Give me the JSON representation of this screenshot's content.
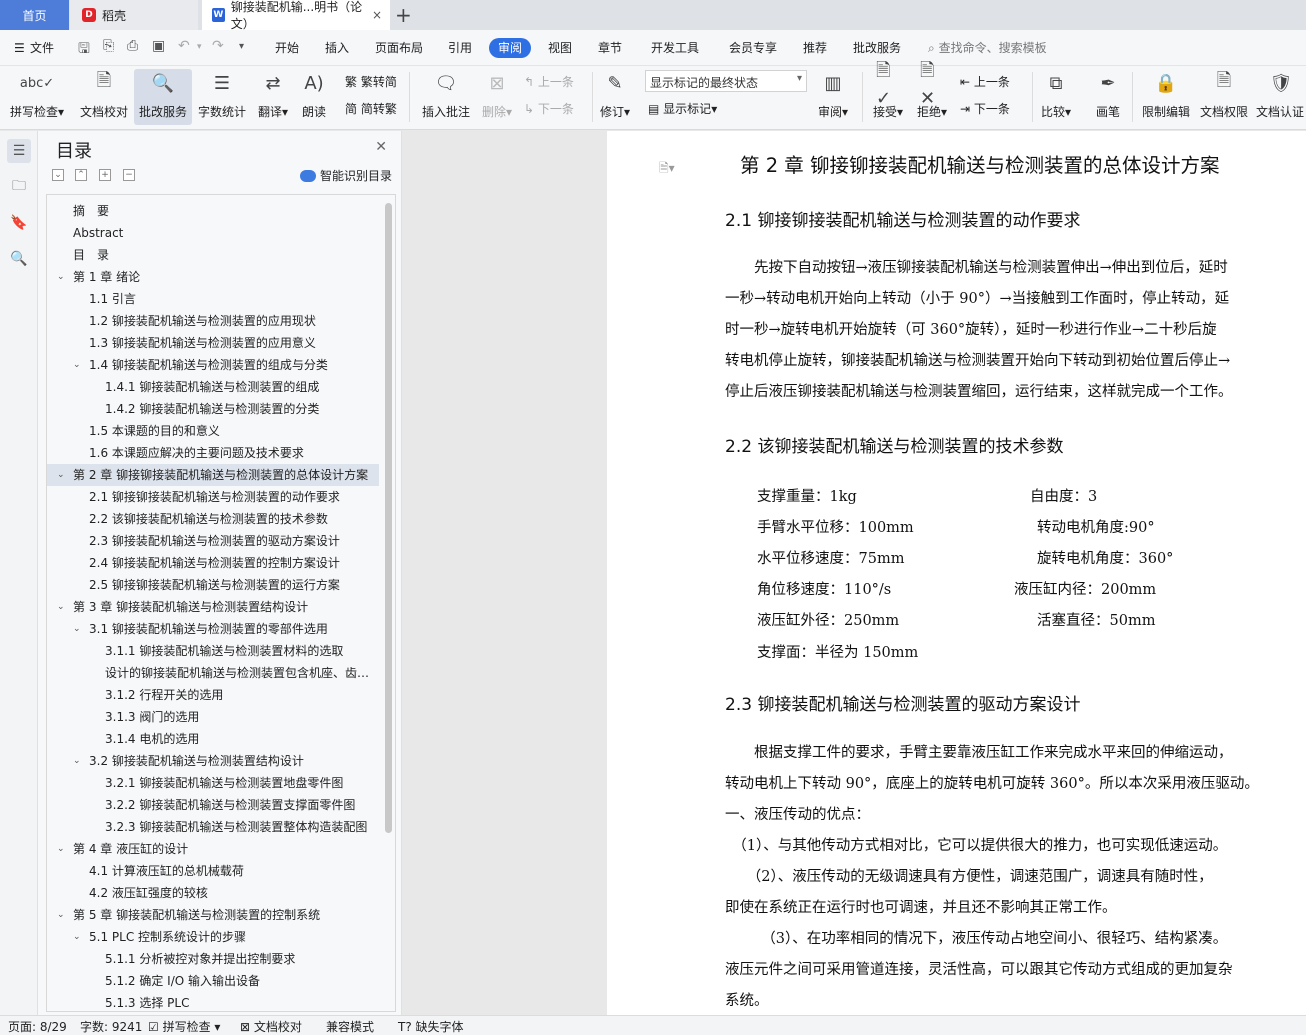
{
  "tabs": {
    "home": "首页",
    "daoke": "稻壳",
    "doc": "铆接装配机输...明书（论文）",
    "close": "×",
    "add": "+"
  },
  "menu": {
    "file": "文件",
    "items": [
      "开始",
      "插入",
      "页面布局",
      "引用",
      "审阅",
      "视图",
      "章节",
      "开发工具",
      "会员专享",
      "推荐",
      "批改服务"
    ],
    "search": "查找命令、搜索模板"
  },
  "ribbon": {
    "spell": "拼写检查",
    "proofread": "文档校对",
    "correction": "批改服务",
    "wordcount": "字数统计",
    "translate": "翻译",
    "read": "朗读",
    "to_trad": "繁转简",
    "to_simp": "简转繁",
    "insert_comment": "插入批注",
    "delete": "删除",
    "prev_comment": "上一条",
    "next_comment": "下一条",
    "track": "修订",
    "markup_select": "显示标记的最终状态",
    "show_markup": "显示标记",
    "review": "审阅",
    "accept": "接受",
    "reject": "拒绝",
    "prev_change": "上一条",
    "next_change": "下一条",
    "compare": "比较",
    "pen": "画笔",
    "restrict": "限制编辑",
    "permission": "文档权限",
    "certify": "文档认证"
  },
  "toc": {
    "title": "目录",
    "smart": "智能识别目录",
    "items": [
      {
        "text": "摘　要",
        "level": 1,
        "caret": ""
      },
      {
        "text": "Abstract",
        "level": 1,
        "caret": ""
      },
      {
        "text": "目　录",
        "level": 1,
        "caret": ""
      },
      {
        "text": "第 1 章  绪论",
        "level": 1,
        "caret": "v"
      },
      {
        "text": "1.1 引言",
        "level": 2,
        "caret": ""
      },
      {
        "text": "1.2  铆接装配机输送与检测装置的应用现状",
        "level": 2,
        "caret": ""
      },
      {
        "text": "1.3  铆接装配机输送与检测装置的应用意义",
        "level": 2,
        "caret": ""
      },
      {
        "text": "1.4 铆接装配机输送与检测装置的组成与分类",
        "level": 2,
        "caret": "v"
      },
      {
        "text": "1.4.1 铆接装配机输送与检测装置的组成",
        "level": 3,
        "caret": ""
      },
      {
        "text": "1.4.2 铆接装配机输送与检测装置的分类",
        "level": 3,
        "caret": ""
      },
      {
        "text": "1.5 本课题的目的和意义",
        "level": 2,
        "caret": ""
      },
      {
        "text": "1.6  本课题应解决的主要问题及技术要求",
        "level": 2,
        "caret": ""
      },
      {
        "text": "第 2 章  铆接铆接装配机输送与检测装置的总体设计方案",
        "level": 1,
        "caret": "v",
        "selected": true
      },
      {
        "text": "2.1  铆接铆接装配机输送与检测装置的动作要求",
        "level": 2,
        "caret": ""
      },
      {
        "text": "2.2 该铆接装配机输送与检测装置的技术参数",
        "level": 2,
        "caret": ""
      },
      {
        "text": "2.3 铆接装配机输送与检测装置的驱动方案设计",
        "level": 2,
        "caret": ""
      },
      {
        "text": "2.4 铆接装配机输送与检测装置的控制方案设计",
        "level": 2,
        "caret": ""
      },
      {
        "text": "2.5 铆接铆接装配机输送与检测装置的运行方案",
        "level": 2,
        "caret": ""
      },
      {
        "text": "第 3 章  铆接装配机输送与检测装置结构设计",
        "level": 1,
        "caret": "v"
      },
      {
        "text": "3.1 铆接装配机输送与检测装置的零部件选用",
        "level": 2,
        "caret": "v"
      },
      {
        "text": "3.1.1 铆接装配机输送与检测装置材料的选取",
        "level": 3,
        "caret": ""
      },
      {
        "text": "设计的铆接装配机输送与检测装置包含机座、齿轮、连接件等",
        "level": 3,
        "caret": ""
      },
      {
        "text": "3.1.2 行程开关的选用",
        "level": 3,
        "caret": ""
      },
      {
        "text": "3.1.3 阀门的选用",
        "level": 3,
        "caret": ""
      },
      {
        "text": "3.1.4 电机的选用",
        "level": 3,
        "caret": ""
      },
      {
        "text": "3.2 铆接装配机输送与检测装置结构设计",
        "level": 2,
        "caret": "v"
      },
      {
        "text": "3.2.1 铆接装配机输送与检测装置地盘零件图",
        "level": 3,
        "caret": ""
      },
      {
        "text": "3.2.2 铆接装配机输送与检测装置支撑面零件图",
        "level": 3,
        "caret": ""
      },
      {
        "text": "3.2.3 铆接装配机输送与检测装置整体构造装配图",
        "level": 3,
        "caret": ""
      },
      {
        "text": "第 4 章  液压缸的设计",
        "level": 1,
        "caret": "v"
      },
      {
        "text": "4.1 计算液压缸的总机械载荷",
        "level": 2,
        "caret": ""
      },
      {
        "text": "4.2 液压缸强度的较核",
        "level": 2,
        "caret": ""
      },
      {
        "text": "第 5 章  铆接装配机输送与检测装置的控制系统",
        "level": 1,
        "caret": "v"
      },
      {
        "text": "5.1 PLC 控制系统设计的步骤",
        "level": 2,
        "caret": "v"
      },
      {
        "text": "5.1.1 分析被控对象并提出控制要求",
        "level": 3,
        "caret": ""
      },
      {
        "text": "5.1.2 确定 I/O 输入输出设备",
        "level": 3,
        "caret": ""
      },
      {
        "text": "5.1.3 选择 PLC",
        "level": 3,
        "caret": ""
      }
    ]
  },
  "doc": {
    "chapter_title": "第 2 章  铆接铆接装配机输送与检测装置的总体设计方案",
    "s21_title": "2.1  铆接铆接装配机输送与检测装置的动作要求",
    "s21_lines": [
      "　　先按下自动按钮→液压铆接装配机输送与检测装置伸出→伸出到位后，延时",
      "一秒→转动电机开始向上转动（小于 90°）→当接触到工作面时，停止转动，延",
      "时一秒→旋转电机开始旋转（可 360°旋转），延时一秒进行作业→二十秒后旋",
      "转电机停止旋转，铆接装配机输送与检测装置开始向下转动到初始位置后停止→",
      "停止后液压铆接装配机输送与检测装置缩回，运行结束，这样就完成一个工作。"
    ],
    "s22_title": "2.2 该铆接装配机输送与检测装置的技术参数",
    "params": [
      "支撑重量：1kg",
      "自由度：3",
      "手臂水平位移：100mm",
      "转动电机角度:90°",
      "水平位移速度：75mm",
      "旋转电机角度：360°",
      "角位移速度：110°/s",
      "液压缸内径：200mm",
      "液压缸外径：250mm",
      "活塞直径：50mm",
      "支撑面：半径为 150mm"
    ],
    "s23_title": "2.3 铆接装配机输送与检测装置的驱动方案设计",
    "s23_lines": [
      "　　根据支撑工件的要求，手臂主要靠液压缸工作来完成水平来回的伸缩运动，",
      "转动电机上下转动 90°，底座上的旋转电机可旋转 360°。所以本次采用液压驱动。",
      "一、液压传动的优点：",
      "　（1）、与其他传动方式相对比，它可以提供很大的推力，也可实现低速运动。",
      "　　（2）、液压传动的无级调速具有方便性，调速范围广，调速具有随时性，",
      "即使在系统正在运行时也可调速，并且还不影响其正常工作。",
      "　　　（3）、在功率相同的情况下，液压传动占地空间小、很轻巧、结构紧凑。",
      "液压元件之间可采用管道连接，灵活性高，可以跟其它传动方式组成的更加复杂",
      "系统。"
    ]
  },
  "status": {
    "page": "页面: 8/29",
    "words": "字数: 9241",
    "spell": "拼写检查",
    "proof": "文档校对",
    "compat": "兼容模式",
    "font": "缺失字体"
  },
  "colors": {
    "accent": "#2f6fe4",
    "home_tab": "#4e7dd9",
    "daoke_logo": "#e1242a"
  }
}
